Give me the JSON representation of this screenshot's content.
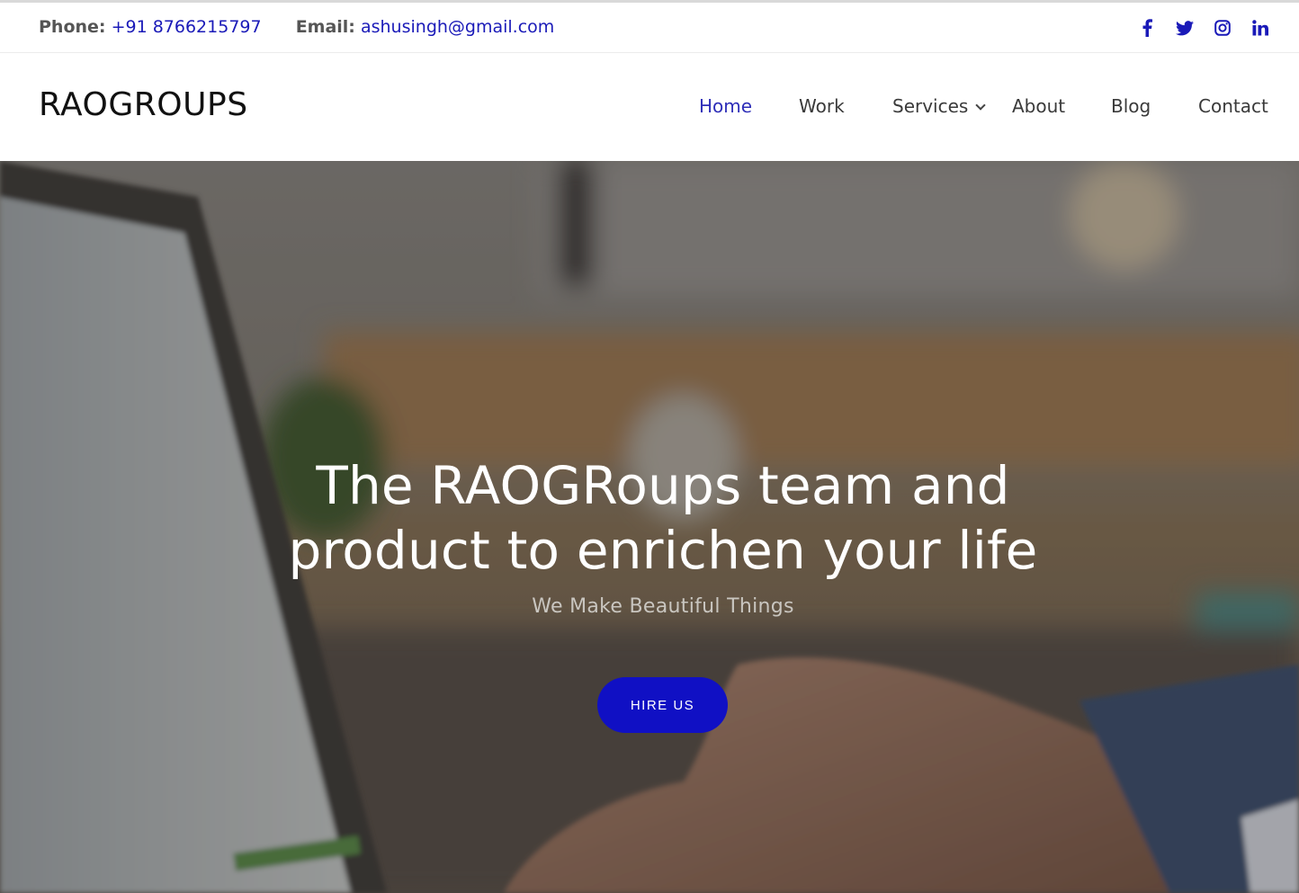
{
  "topbar": {
    "phone_label": "Phone:",
    "phone_value": "+91 8766215797",
    "email_label": "Email:",
    "email_value": "ashusingh@gmail.com",
    "social": [
      "facebook-icon",
      "twitter-icon",
      "instagram-icon",
      "linkedin-icon"
    ]
  },
  "header": {
    "logo": "RAOGROUPS",
    "nav": {
      "home": "Home",
      "work": "Work",
      "services": "Services",
      "about": "About",
      "blog": "Blog",
      "contact": "Contact"
    },
    "active": "Home"
  },
  "hero": {
    "headline_line1": "The RAOGRoups team and",
    "headline_line2": "product to enrichen your life",
    "subline": "We Make Beautiful Things",
    "cta": "HIRE US"
  },
  "colors": {
    "accent": "#1010c4",
    "link": "#1a1ab8",
    "text": "#3a3a3a"
  }
}
